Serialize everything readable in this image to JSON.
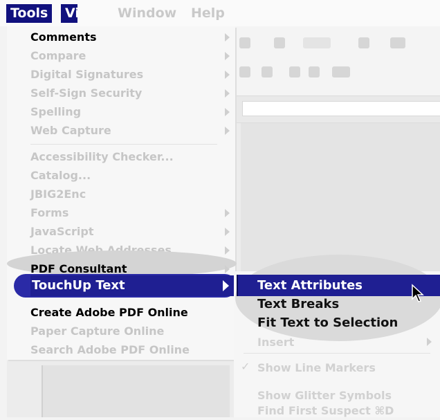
{
  "menubar": {
    "tools": "Tools",
    "view": "View",
    "window": "Window",
    "help": "Help"
  },
  "tools_menu": {
    "items": [
      {
        "label": "Comments",
        "submenu": true
      },
      {
        "label": "Compare",
        "submenu": true
      },
      {
        "label": "Digital Signatures",
        "submenu": true
      },
      {
        "label": "Self-Sign Security",
        "submenu": true
      },
      {
        "label": "Spelling",
        "submenu": true
      },
      {
        "label": "Web Capture",
        "submenu": true
      },
      {
        "label": "Accessibility Checker...",
        "submenu": false
      },
      {
        "label": "Catalog...",
        "submenu": false
      },
      {
        "label": "JBIG2Enc",
        "submenu": false
      },
      {
        "label": "Forms",
        "submenu": true
      },
      {
        "label": "JavaScript",
        "submenu": true
      },
      {
        "label": "Locate Web Addresses",
        "submenu": true
      },
      {
        "label": "PDF Consultant",
        "submenu": true
      },
      {
        "label": "TouchUp Text",
        "submenu": true
      },
      {
        "label": "Create Adobe PDF Online",
        "submenu": false
      },
      {
        "label": "Paper Capture Online",
        "submenu": false
      },
      {
        "label": "Search Adobe PDF Online",
        "submenu": false
      }
    ],
    "selected": "TouchUp Text"
  },
  "touchup_submenu": {
    "items": [
      {
        "label": "Text Attributes",
        "selected": true
      },
      {
        "label": "Text Breaks"
      },
      {
        "label": "Fit Text to Selection"
      },
      {
        "label": "Insert",
        "submenu": true
      },
      {
        "label": "Show Line Markers",
        "checked": true
      },
      {
        "label": "Show Glitter Symbols"
      },
      {
        "label": "Find First Suspect"
      }
    ],
    "shortcut": "⌘D"
  },
  "colors": {
    "highlight": "#1f1f92",
    "menubar_active": "#11117e",
    "faded_text": "#c6c6c6"
  }
}
